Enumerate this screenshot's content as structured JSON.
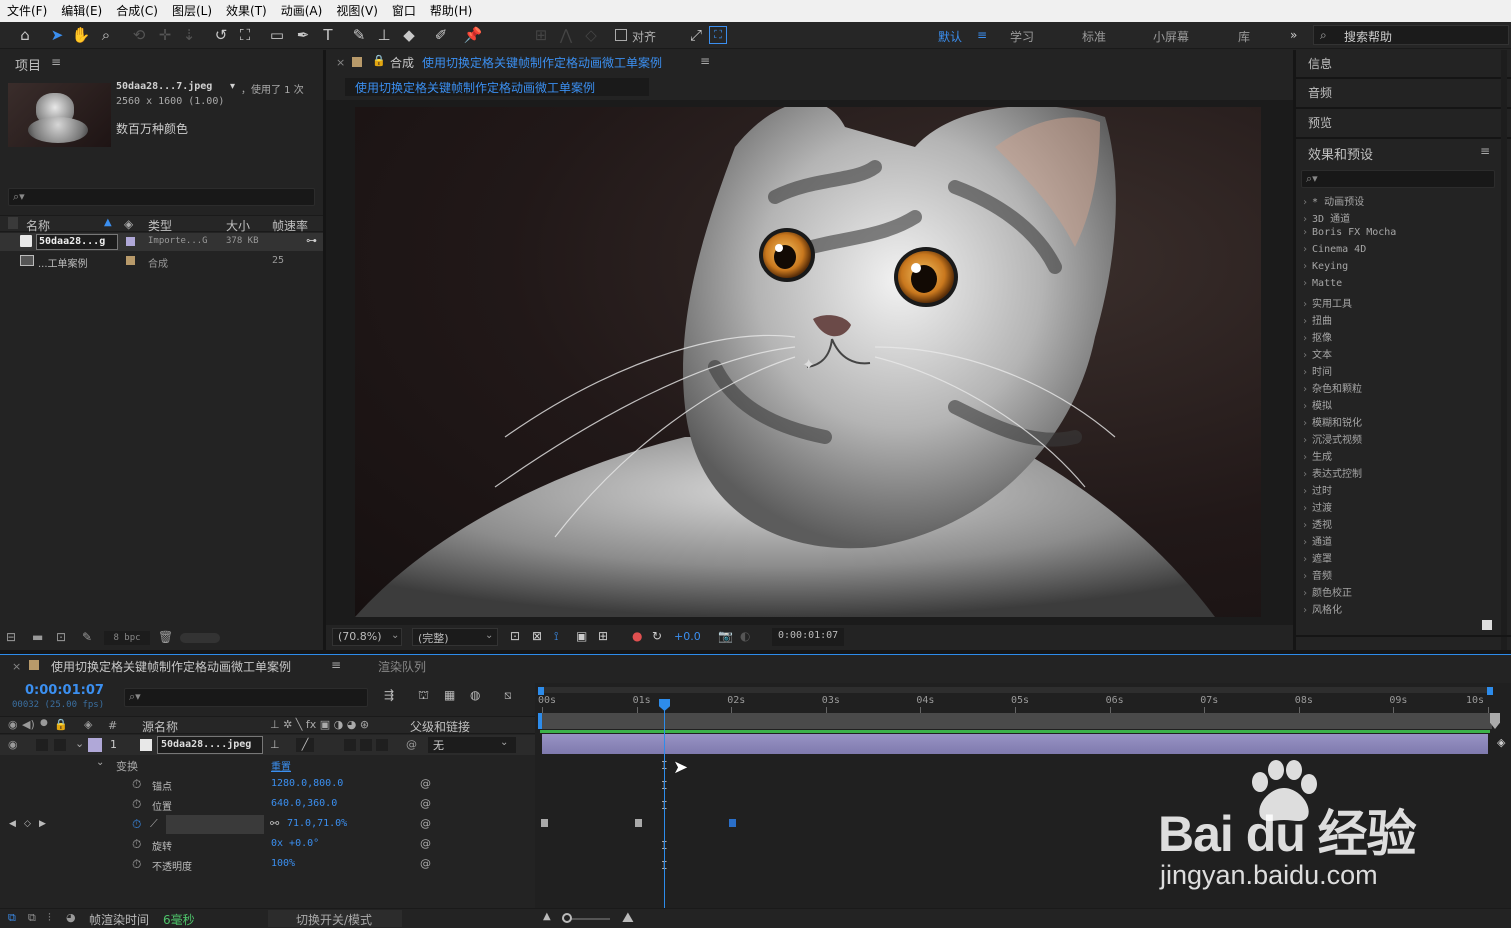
{
  "menu": [
    "文件(F)",
    "编辑(E)",
    "合成(C)",
    "图层(L)",
    "效果(T)",
    "动画(A)",
    "视图(V)",
    "窗口",
    "帮助(H)"
  ],
  "toolbar": {
    "align_label": "对齐",
    "workspaces": [
      "默认",
      "学习",
      "标准",
      "小屏幕",
      "库"
    ],
    "search_label": "搜索帮助"
  },
  "project": {
    "title": "项目",
    "file_name": "50daa28...7.jpeg",
    "used": "，使用了 1 次",
    "dimensions": "2560 x 1600 (1.00)",
    "colors": "数百万种颜色",
    "columns": [
      "名称",
      "类型",
      "大小",
      "帧速率"
    ],
    "rows": [
      {
        "name": "50daa28...g",
        "type": "Importe...G",
        "size": "378 KB",
        "fps": ""
      },
      {
        "name": "...工单案例",
        "type": "合成",
        "size": "",
        "fps": "25"
      }
    ],
    "bpc": "8 bpc"
  },
  "composition": {
    "tab_prefix": "合成",
    "tab_name": "使用切换定格关键帧制作定格动画微工单案例",
    "subtab": "使用切换定格关键帧制作定格动画微工单案例",
    "zoom": "(70.8%)",
    "quality": "(完整)",
    "exposure": "+0.0",
    "timecode": "0:00:01:07"
  },
  "right_panels": {
    "items": [
      "信息",
      "音频",
      "预览"
    ],
    "effects_title": "效果和预设",
    "effects": [
      "* 动画预设",
      "3D 通道",
      "Boris FX Mocha",
      "Cinema 4D",
      "Keying",
      "Matte",
      "实用工具",
      "扭曲",
      "抠像",
      "文本",
      "时间",
      "杂色和颗粒",
      "模拟",
      "模糊和锐化",
      "沉浸式视频",
      "生成",
      "表达式控制",
      "过时",
      "过渡",
      "透视",
      "通道",
      "遮罩",
      "音频",
      "颜色校正",
      "风格化"
    ]
  },
  "timeline": {
    "tab_name": "使用切换定格关键帧制作定格动画微工单案例",
    "render_queue": "渲染队列",
    "current_time": "0:00:01:07",
    "frame_info": "00032 (25.00 fps)",
    "col_source": "源名称",
    "col_parent": "父级和链接",
    "ruler": [
      "00s",
      "01s",
      "02s",
      "03s",
      "04s",
      "05s",
      "06s",
      "07s",
      "08s",
      "09s",
      "10s"
    ],
    "layer": {
      "index": "1",
      "name": "50daa28....jpeg",
      "parent": "无"
    },
    "transform_label": "变换",
    "reset_label": "重置",
    "properties": [
      {
        "name": "锚点",
        "value": "1280.0,800.0"
      },
      {
        "name": "位置",
        "value": "640.0,360.0"
      },
      {
        "name": "缩放",
        "value": "71.0,71.0%"
      },
      {
        "name": "旋转",
        "value": "0x +0.0°"
      },
      {
        "name": "不透明度",
        "value": "100%"
      }
    ],
    "footer_render_label": "帧渲染时间",
    "footer_render_value": "6毫秒",
    "footer_toggle": "切换开关/模式"
  },
  "watermark": {
    "brand": "Bai du 经验",
    "url": "jingyan.baidu.com"
  },
  "colors": {
    "accent": "#2d8ceb",
    "layer_bar": "#8a86b8",
    "keyframe": "#2a6fc9"
  }
}
